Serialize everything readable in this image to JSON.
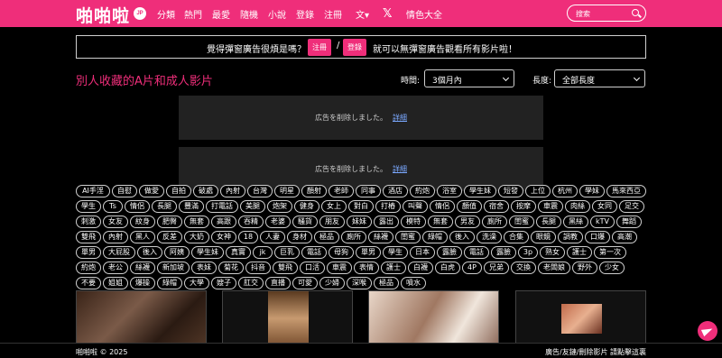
{
  "brand": {
    "logo_text": "啪啪啦",
    "badge": "JP",
    "accent_color": "#ef2e7a"
  },
  "nav": {
    "items": [
      "分類",
      "熱門",
      "最愛",
      "隨機",
      "小說",
      "登錄",
      "注冊"
    ],
    "lang_icon": "translate-icon",
    "extra": "情色大全"
  },
  "search": {
    "placeholder": "搜索",
    "icon": "search-icon"
  },
  "banner": {
    "text_before": "覺得彈窗廣告很煩是嗎？",
    "register_label": "注冊",
    "separator": "/",
    "login_label": "登錄",
    "text_after": "就可以無彈窗廣告觀看所有影片啦！"
  },
  "page": {
    "title": "別人收藏的A片和成人影片"
  },
  "filters": {
    "time_label": "時間:",
    "time_value": "3個月內",
    "length_label": "長度:",
    "length_value": "全部長度"
  },
  "ads": [
    {
      "text": "広告を削除しました。",
      "link": "詳細"
    },
    {
      "text": "広告を削除しました。",
      "link": "詳細"
    }
  ],
  "tags": [
    [
      "AI手淫",
      "自慰",
      "做愛",
      "自拍",
      "破處",
      "內射",
      "台灣",
      "明星",
      "顏射",
      "老師",
      "同事",
      "酒店",
      "約炮",
      "浴室",
      "學生妹",
      "短發",
      "上位",
      "杭州",
      "學妹",
      "馬來西亞"
    ],
    [
      "學生",
      "Ts",
      "情侶",
      "長腿",
      "豐滿",
      "打電話",
      "美腿",
      "炮架",
      "健身",
      "女上",
      "對白",
      "打樁",
      "叫聲",
      "情侶",
      "顏值",
      "宿舍",
      "按摩",
      "車震",
      "肉絲",
      "女同",
      "足交"
    ],
    [
      "刺激",
      "女友",
      "紋身",
      "肥臀",
      "無套",
      "高跟",
      "吞精",
      "老婆",
      "騷貨",
      "朋友",
      "妹妹",
      "露出",
      "模特",
      "無套",
      "男友",
      "廁所",
      "閨蜜",
      "長腿",
      "黑絲",
      "kTV",
      "舞蹈",
      "少婦"
    ],
    [
      "雙飛",
      "內射",
      "黑人",
      "反差",
      "大奶",
      "女神",
      "18",
      "人妻",
      "身材",
      "極品",
      "廁所",
      "絲襪",
      "閨蜜",
      "綠帽",
      "後入",
      "洗澡",
      "合集",
      "眼鏡",
      "調教",
      "口爆",
      "高潮",
      "口交"
    ],
    [
      "單男",
      "大屁股",
      "後入",
      "阿姨",
      "學生妹",
      "真實",
      "jk",
      "巨乳",
      "電話",
      "母狗",
      "單男",
      "學生",
      "日本",
      "露臉",
      "電話",
      "露臉",
      "3p",
      "熟女",
      "護士",
      "第一次",
      "出軌"
    ],
    [
      "約炮",
      "老公",
      "絲襪",
      "新加坡",
      "表妹",
      "菊花",
      "抖音",
      "雙飛",
      "口活",
      "車震",
      "表情",
      "護士",
      "白襪",
      "白虎",
      "4P",
      "兄弟",
      "交換",
      "老闆娘",
      "野外",
      "少女",
      "女上位"
    ],
    [
      "不要",
      "姐姐",
      "爆操",
      "綠帽",
      "大學",
      "嫂子",
      "肛交",
      "直播",
      "可愛",
      "少婦",
      "深喉",
      "極品",
      "噴水"
    ]
  ],
  "thumbnails": [
    {
      "icon": "video-thumbnail-1"
    },
    {
      "icon": "video-thumbnail-2"
    },
    {
      "icon": "video-thumbnail-3"
    },
    {
      "icon": "video-thumbnail-4"
    }
  ],
  "footer": {
    "left": "啪啪啦 © 2025",
    "right": "廣告/友鏈/刪除影片 請點擊這裏"
  },
  "floating": {
    "icon": "telegram-icon"
  }
}
